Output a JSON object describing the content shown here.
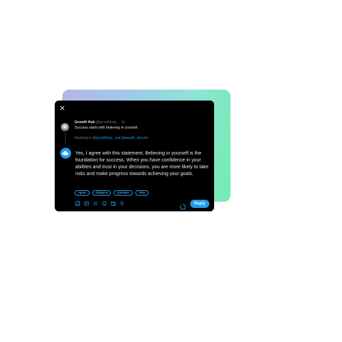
{
  "original_tweet": {
    "author_name": "Growth Hub",
    "meta": "@growthhub_ · 1h",
    "text": "Success starts with believing in yourself."
  },
  "replying_to": {
    "prefix": "Replying to ",
    "mentions": "@growthhub_ and @wealth_director"
  },
  "reply": {
    "text": "Yes, I agree with this statement. Believing in yourself is the foundation for success. When you have confidence in your abilities and trust in your decisions, you are more likely to take risks and make progress towards achieving your goals."
  },
  "chips": [
    "Agree",
    "Disagree",
    "Question",
    "Joke"
  ],
  "toolbar_icons": [
    "image-icon",
    "gif-icon",
    "poll-icon",
    "emoji-icon",
    "schedule-icon",
    "location-icon"
  ],
  "reply_button_label": "Reply",
  "colors": {
    "accent": "#1d9bf0",
    "background": "#000000",
    "text": "#e7e9ea",
    "muted": "#71767b"
  }
}
